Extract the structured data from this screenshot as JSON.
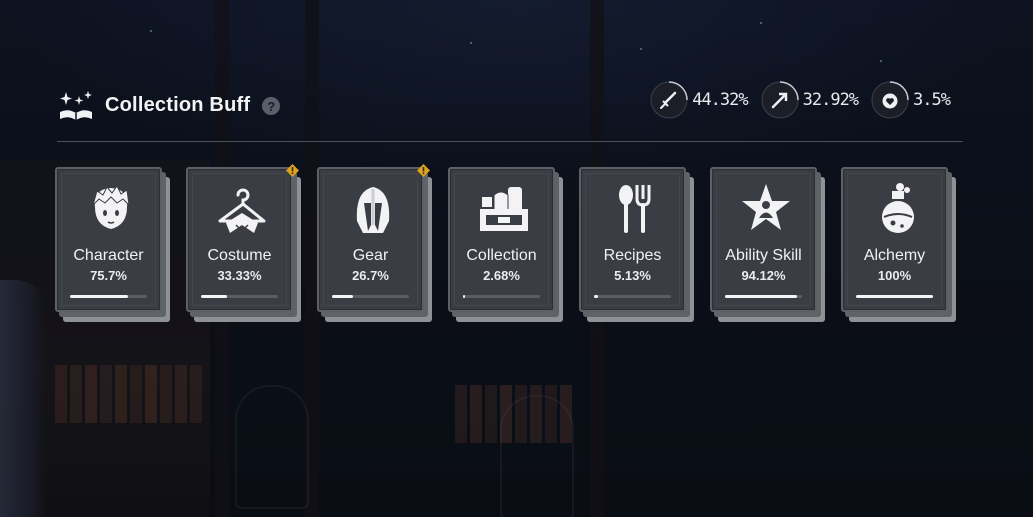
{
  "header": {
    "title": "Collection Buff",
    "help_label": "?"
  },
  "stats": [
    {
      "icon": "sword-icon",
      "value": "44.32%"
    },
    {
      "icon": "arrow-icon",
      "value": "32.92%"
    },
    {
      "icon": "heart-icon",
      "value": "3.5%"
    }
  ],
  "cards": [
    {
      "label": "Character",
      "percent": "75.7%",
      "progress": 0.757,
      "icon": "character-icon",
      "alert": false
    },
    {
      "label": "Costume",
      "percent": "33.33%",
      "progress": 0.3333,
      "icon": "costume-hanger-icon",
      "alert": true
    },
    {
      "label": "Gear",
      "percent": "26.7%",
      "progress": 0.267,
      "icon": "helmet-icon",
      "alert": true
    },
    {
      "label": "Collection",
      "percent": "2.68%",
      "progress": 0.0268,
      "icon": "collection-box-icon",
      "alert": false
    },
    {
      "label": "Recipes",
      "percent": "5.13%",
      "progress": 0.0513,
      "icon": "spoon-fork-icon",
      "alert": false
    },
    {
      "label": "Ability Skill",
      "percent": "94.12%",
      "progress": 0.9412,
      "icon": "star-skill-icon",
      "alert": false
    },
    {
      "label": "Alchemy",
      "percent": "100%",
      "progress": 1.0,
      "icon": "potion-icon",
      "alert": false
    }
  ],
  "colors": {
    "card_face": "#3a3d43",
    "alert": "#e0a21c",
    "progress_fill": "#f4f4f6",
    "background": "#0b0f18"
  }
}
